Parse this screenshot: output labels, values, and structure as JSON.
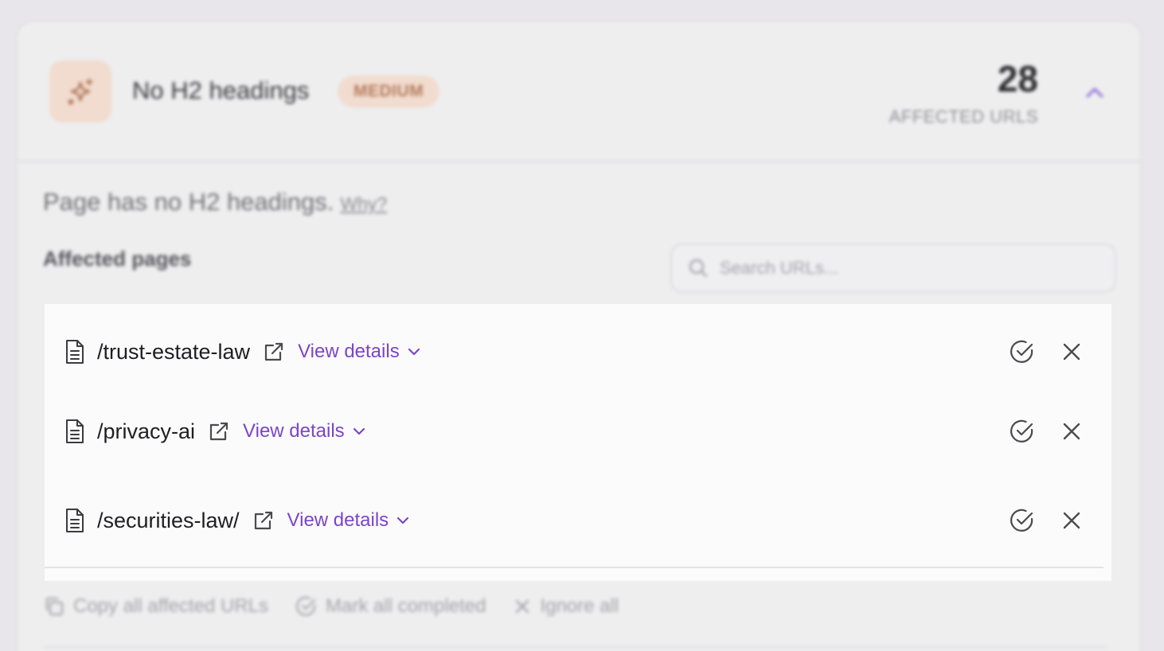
{
  "issue": {
    "icon": "sparkle-icon",
    "title": "No H2 headings",
    "severity": "MEDIUM",
    "affected_count": "28",
    "affected_label": "AFFECTED URLS",
    "description": "Page has no H2 headings.",
    "why_link": "Why?",
    "affected_pages_heading": "Affected pages"
  },
  "search": {
    "placeholder": "Search URLs..."
  },
  "pages": [
    {
      "path": "/trust-estate-law",
      "details_label": "View details"
    },
    {
      "path": "/privacy-ai",
      "details_label": "View details"
    },
    {
      "path": "/securities-law/",
      "details_label": "View details"
    }
  ],
  "footer": {
    "copy_label": "Copy all affected URLs",
    "complete_label": "Mark all completed",
    "ignore_label": "Ignore all"
  },
  "colors": {
    "accent": "#7a45c9",
    "badge_bg": "#f1dccf",
    "badge_text": "#b57a5b",
    "panel_bg": "#fbfbfb"
  }
}
